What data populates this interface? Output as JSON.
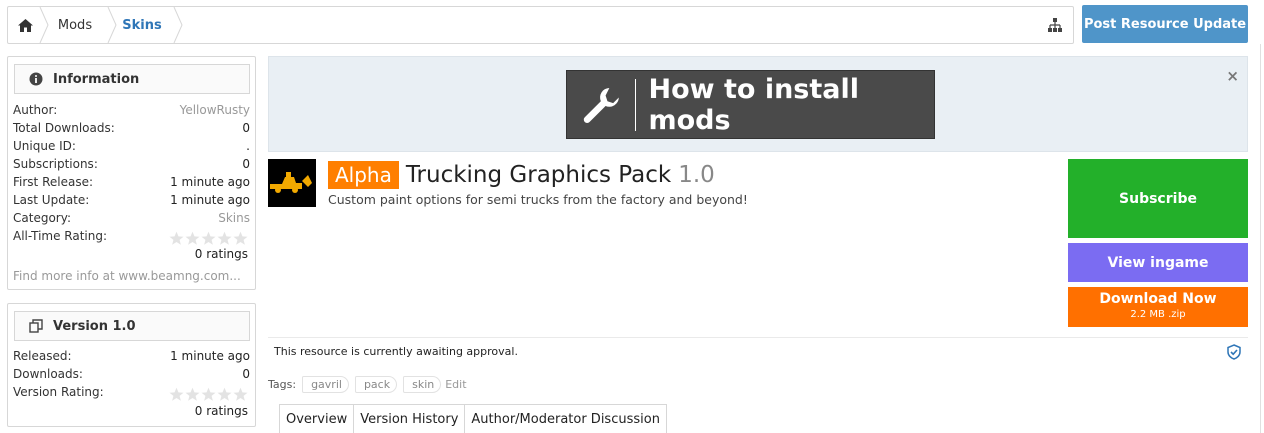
{
  "breadcrumb": {
    "home_icon": "home-icon",
    "items": [
      "Mods",
      "Skins"
    ],
    "sitemap_icon": "sitemap-icon"
  },
  "header": {
    "post_button_label": "Post Resource Update"
  },
  "information": {
    "title": "Information",
    "icon": "info-icon",
    "rows": [
      {
        "label": "Author:",
        "value": "YellowRusty"
      },
      {
        "label": "Total Downloads:",
        "value": "0"
      },
      {
        "label": "Unique ID:",
        "value": "."
      },
      {
        "label": "Subscriptions:",
        "value": "0"
      },
      {
        "label": "First Release:",
        "value": "1 minute ago"
      },
      {
        "label": "Last Update:",
        "value": "1 minute ago"
      },
      {
        "label": "Category:",
        "value": "Skins"
      }
    ],
    "rating_label": "All-Time Rating:",
    "rating_count": "0 ratings",
    "rating_stars": 0,
    "find_more": "Find more info at www.beamng.com..."
  },
  "version_box": {
    "title": "Version 1.0",
    "icon": "copy-icon",
    "rows": [
      {
        "label": "Released:",
        "value": "1 minute ago"
      },
      {
        "label": "Downloads:",
        "value": "0"
      }
    ],
    "rating_label": "Version Rating:",
    "rating_count": "0 ratings",
    "rating_stars": 0
  },
  "banner": {
    "text": "How to install mods",
    "icon": "wrench-icon",
    "close": "×"
  },
  "resource": {
    "badge": "Alpha",
    "title": "Trucking Graphics Pack",
    "version": "1.0",
    "tagline": "Custom paint options for semi trucks from the factory and beyond!"
  },
  "actions": {
    "subscribe": "Subscribe",
    "view_ingame": "View ingame",
    "download": "Download Now",
    "download_meta": "2.2 MB .zip"
  },
  "approval_text": "This resource is currently awaiting approval.",
  "tags": {
    "label": "Tags:",
    "items": [
      "gavril",
      "pack",
      "skin"
    ],
    "edit": "Edit"
  },
  "tabs": [
    "Overview",
    "Version History",
    "Author/Moderator Discussion"
  ],
  "colors": {
    "accent_blue": "#4f95c9",
    "subscribe_green": "#23b02a",
    "view_purple": "#7b6cf2",
    "download_orange": "#ff7000",
    "badge_orange": "#ff7f00"
  }
}
